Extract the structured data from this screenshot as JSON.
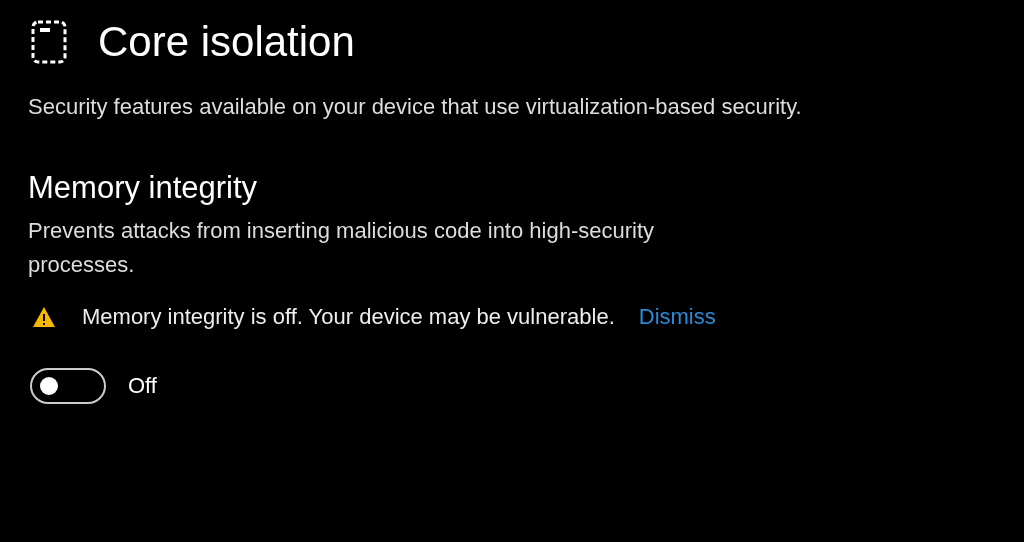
{
  "page": {
    "title": "Core isolation",
    "description": "Security features available on your device that use virtualization-based security."
  },
  "section": {
    "title": "Memory integrity",
    "description": "Prevents attacks from inserting malicious code into high-security processes.",
    "warning": {
      "text": "Memory integrity is off. Your device may be vulnerable.",
      "link": "Dismiss"
    },
    "toggle": {
      "on": false,
      "label": "Off"
    }
  }
}
